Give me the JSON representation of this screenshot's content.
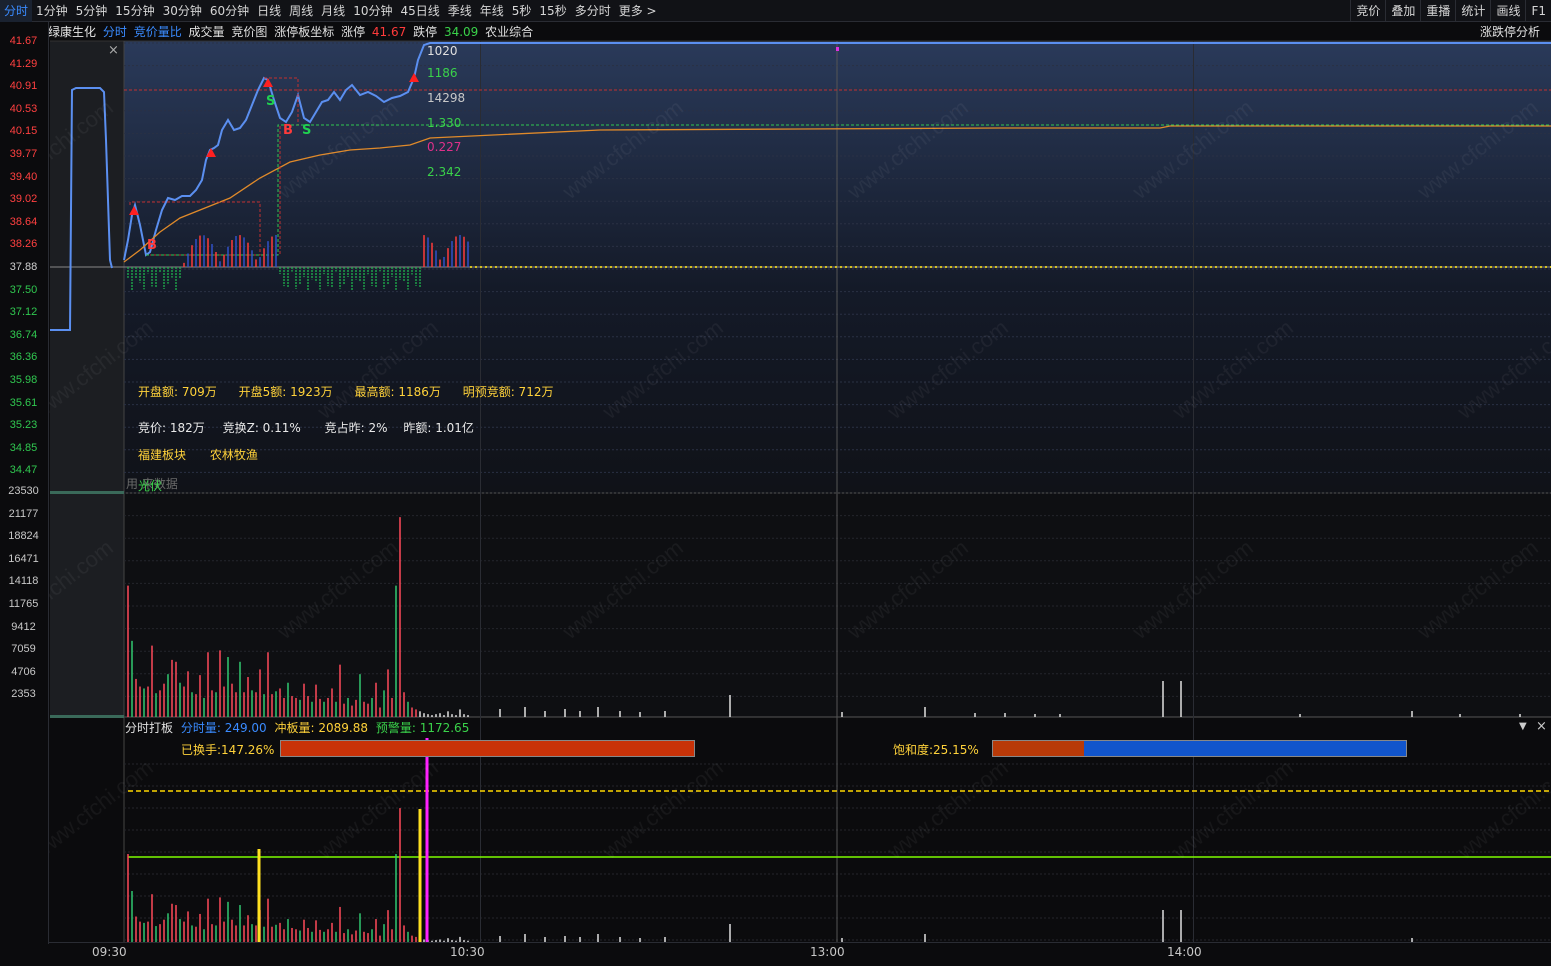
{
  "periods": [
    "分时",
    "1分钟",
    "5分钟",
    "15分钟",
    "30分钟",
    "60分钟",
    "日线",
    "周线",
    "月线",
    "10分钟",
    "45日线",
    "季线",
    "年线",
    "5秒",
    "15秒",
    "多分时",
    "更多 >"
  ],
  "active_period": "分时",
  "right_buttons": [
    "竞价",
    "叠加",
    "重播",
    "统计",
    "画线",
    "F1"
  ],
  "info": {
    "stock_name": "绿康生化",
    "tabs": [
      "分时",
      "竞价量比",
      "成交量",
      "竞价图",
      "涨停板坐标"
    ],
    "limit_up_label": "涨停",
    "limit_up_value": "41.67",
    "limit_down_label": "跌停",
    "limit_down_value": "34.09",
    "sector": "农业综合",
    "right_link": "涨跌停分析"
  },
  "y_axis_price": [
    "41.67",
    "41.29",
    "40.91",
    "40.53",
    "40.15",
    "39.77",
    "39.40",
    "39.02",
    "38.64",
    "38.26",
    "37.88",
    "37.50",
    "37.12",
    "36.74",
    "36.36",
    "35.98",
    "35.61",
    "35.23",
    "34.85",
    "34.47"
  ],
  "y_axis_volume": [
    "23530",
    "21177",
    "18824",
    "16471",
    "14118",
    "11765",
    "9412",
    "7059",
    "4706",
    "2353"
  ],
  "price_labels": [
    {
      "text": "1020",
      "color": "#e0e0e0"
    },
    {
      "text": "1186",
      "color": "#3ad24a"
    },
    {
      "text": "14298",
      "color": "#c8c8c8"
    },
    {
      "text": "1.330",
      "color": "#3ad24a"
    },
    {
      "text": "0.227",
      "color": "#e0308a"
    },
    {
      "text": "2.342",
      "color": "#3ad24a"
    }
  ],
  "stats": {
    "row1": [
      "开盘额: 709万",
      "开盘5额: 1923万",
      "最高额: 1186万",
      "明预竞额: 712万"
    ],
    "row2": [
      "竞价: 182万",
      "竞换Z: 0.11%",
      "竞占昨: 2%",
      "昨额: 1.01亿"
    ],
    "row3": [
      "福建板块",
      "农林牧渔"
    ],
    "row4": "光伏",
    "ghost_text": "用  来数据"
  },
  "markers": [
    "B",
    "S",
    "B",
    "S"
  ],
  "bottom": {
    "title": "分时打板",
    "fenshi_label": "分时量: 249.00",
    "chongban_label": "冲板量: 2089.88",
    "yujing_label": "预警量: 1172.65",
    "turnover_label": "已换手:147.26%",
    "saturation_label": "饱和度:25.15%",
    "turnover_fill": 1.0,
    "saturation_fill": 0.2215
  },
  "time_axis": [
    "09:30",
    "10:30",
    "13:00",
    "14:00"
  ],
  "colors": {
    "up": "#ff3b3b",
    "down": "#20c050",
    "price_line": "#5b8ff0",
    "avg_line": "#e08a2a",
    "yellow": "#ffd700"
  }
}
